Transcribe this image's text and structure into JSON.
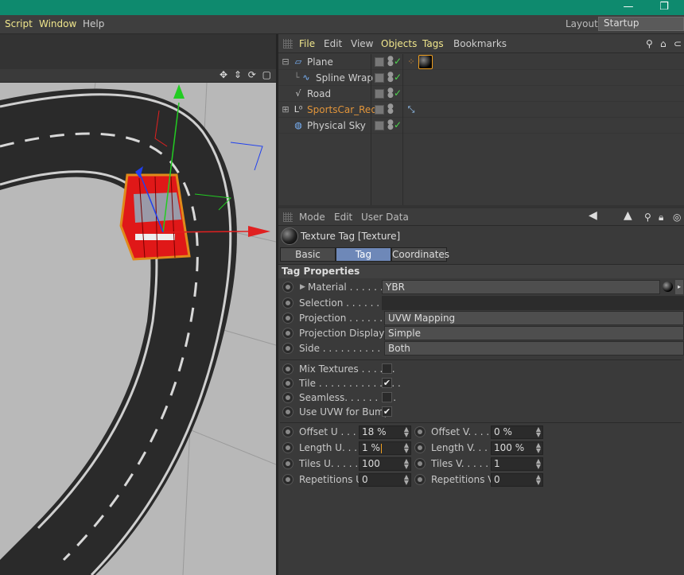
{
  "titlebar": {
    "minimize_glyph": "—",
    "restore_glyph": "❐"
  },
  "menubar": {
    "items": [
      "Script",
      "Window",
      "Help"
    ],
    "layout_label": "Layout:",
    "layout_value": "Startup"
  },
  "viewport": {
    "toolbar_icons": [
      "move-icon",
      "scale-icon",
      "rotate-icon",
      "maximize-icon"
    ]
  },
  "object_manager": {
    "menu": [
      "File",
      "Edit",
      "View",
      "Objects",
      "Tags",
      "Bookmarks"
    ],
    "objects": [
      {
        "name": "Plane",
        "color": "#cfcfcf",
        "icon": "plane-icon"
      },
      {
        "name": "Spline Wrap",
        "color": "#cfcfcf",
        "icon": "spline-wrap-icon"
      },
      {
        "name": "Road",
        "color": "#cfcfcf",
        "icon": "spline-icon"
      },
      {
        "name": "SportsCar_Red",
        "color": "#e0943a",
        "icon": "null-icon"
      },
      {
        "name": "Physical Sky",
        "color": "#cfcfcf",
        "icon": "sky-icon"
      }
    ]
  },
  "attributes": {
    "menu": [
      "Mode",
      "Edit",
      "User Data"
    ],
    "title": "Texture Tag [Texture]",
    "tabs": [
      "Basic",
      "Tag",
      "Coordinates"
    ],
    "active_tab": "Tag",
    "section": "Tag Properties",
    "material": {
      "label": "Material . . . . . . .",
      "value": "YBR"
    },
    "selection": {
      "label": "Selection . . . . . . . . .",
      "value": ""
    },
    "projection": {
      "label": "Projection . . . . . . . .",
      "value": "UVW Mapping"
    },
    "projection_display": {
      "label": "Projection Display",
      "value": "Simple"
    },
    "side": {
      "label": "Side . . . . . . . . . . . . . .",
      "value": "Both"
    },
    "mix_textures": {
      "label": "Mix Textures . . . . . .",
      "checked": false
    },
    "tile": {
      "label": "Tile . . . . . . . . . . . . . .",
      "checked": true,
      "mark": "✔"
    },
    "seamless": {
      "label": "Seamless. . . . . . . . .",
      "checked": false
    },
    "use_uvw_bump": {
      "label": "Use UVW for Bump",
      "checked": true,
      "mark": "✔"
    },
    "offset_u": {
      "label": "Offset U . . . .",
      "value": "18 %"
    },
    "offset_v": {
      "label": "Offset V. . . . .",
      "value": "0 %"
    },
    "length_u": {
      "label": "Length U. . . .",
      "value": "1 %"
    },
    "length_v": {
      "label": "Length V. . . .",
      "value": "100 %"
    },
    "tiles_u": {
      "label": "Tiles U. . . . . .",
      "value": "100"
    },
    "tiles_v": {
      "label": "Tiles V. . . . . .",
      "value": "1"
    },
    "repetitions_u": {
      "label": "Repetitions U",
      "value": "0"
    },
    "repetitions_v": {
      "label": "Repetitions V",
      "value": "0"
    }
  }
}
